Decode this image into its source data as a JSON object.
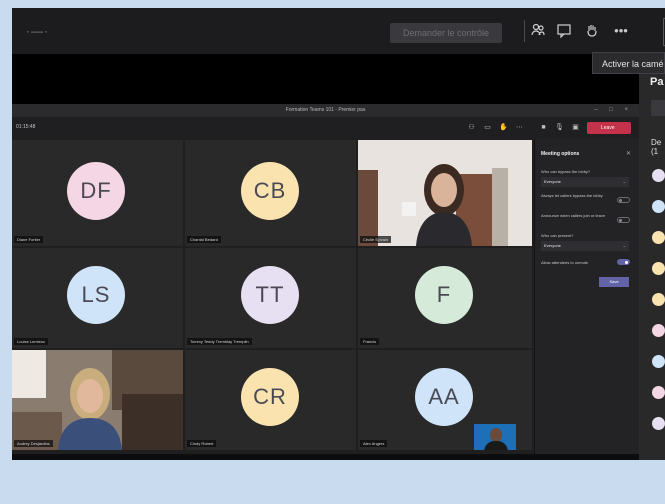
{
  "outer_toolbar": {
    "request_control_label": "Demander le contrôle",
    "dots": "·—·",
    "icons": [
      "participants-icon",
      "chat-icon",
      "raise-hand-icon",
      "more-icon"
    ]
  },
  "tooltip": "Activer la caméra",
  "inner_window": {
    "title": "Formation Teams 101 - Premier pas",
    "timer": "01:15:48",
    "leave_label": "Leave"
  },
  "tiles": [
    {
      "initials": "DF",
      "name": "Diane Fortier",
      "color": "#f4d6e4"
    },
    {
      "initials": "CB",
      "name": "Chantal Bedard",
      "color": "#fbe3b0"
    },
    {
      "initials": "",
      "name": "Cécile Sylvain",
      "video": true
    },
    {
      "initials": "LS",
      "name": "Louise Lemieux",
      "color": "#cfe4f8"
    },
    {
      "initials": "TT",
      "name": "Tommy Teddy Tremblay Tremplin",
      "color": "#e7dff2"
    },
    {
      "initials": "F",
      "name": "Francis",
      "color": "#d6ead9"
    },
    {
      "initials": "",
      "name": "Audrey Desjardins",
      "video": true
    },
    {
      "initials": "CR",
      "name": "Cindy Robert",
      "color": "#fbe3b0"
    },
    {
      "initials": "AA",
      "name": "Alex Angers",
      "color": "#cfe4f8"
    }
  ],
  "meeting_options": {
    "title": "Meeting options",
    "bypass_label": "Who can bypass the lobby?",
    "bypass_value": "Everyone",
    "always_lobby_label": "Always let callers bypass the lobby",
    "announce_label": "Announce when callers join or leave",
    "present_label": "Who can present?",
    "present_value": "Everyone",
    "unmute_label": "Allow attendees to unmute",
    "save_label": "Save"
  },
  "right_panel": {
    "title": "Pa",
    "section": "De\n(1",
    "avatar_colors": [
      "#e7dff2",
      "#cfe4f8",
      "#fbe3b0",
      "#fbe3b0",
      "#fbe3b0",
      "#f4d6e4",
      "#cfe4f8",
      "#f4d6e4",
      "#e7dff2"
    ]
  }
}
